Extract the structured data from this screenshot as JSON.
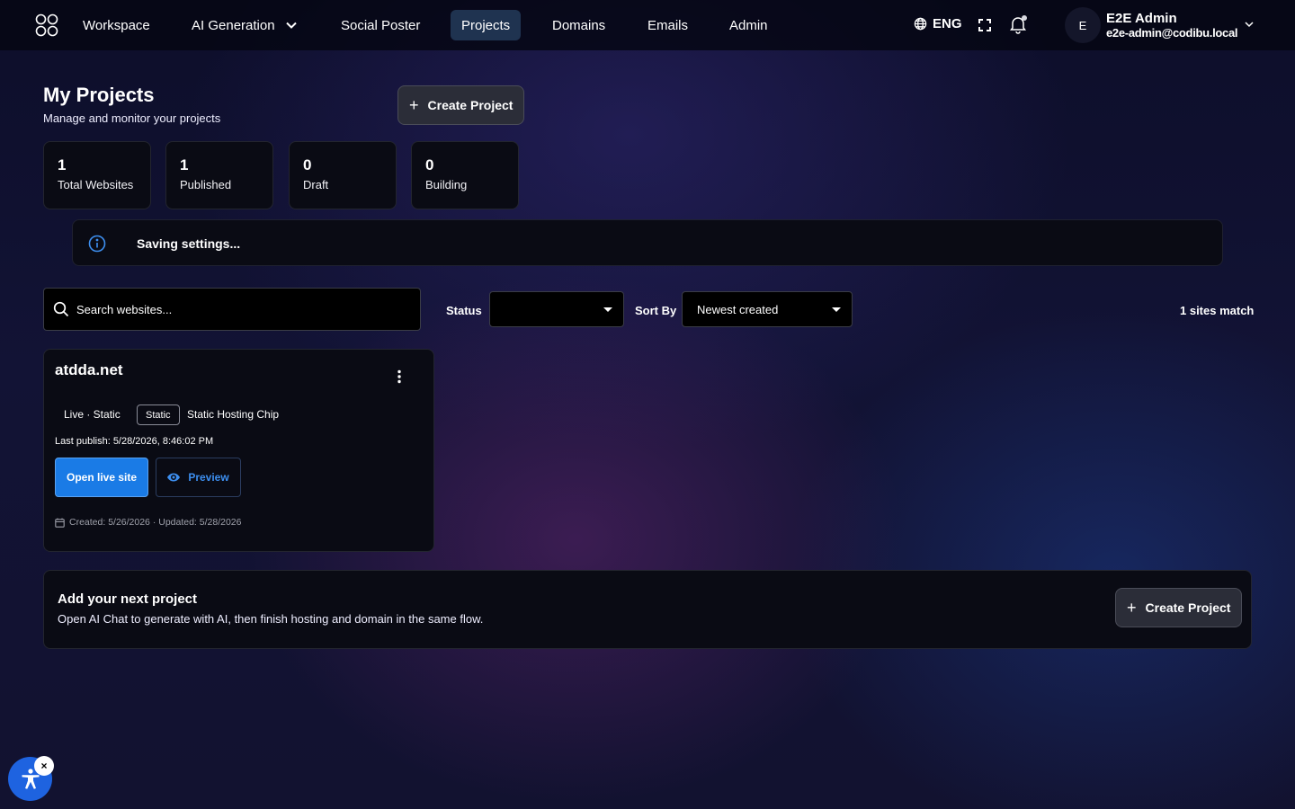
{
  "nav": {
    "items": [
      {
        "label": "Workspace"
      },
      {
        "label": "AI Generation"
      },
      {
        "label": "Social Poster"
      },
      {
        "label": "Projects",
        "active": true
      },
      {
        "label": "Domains"
      },
      {
        "label": "Emails"
      },
      {
        "label": "Admin"
      }
    ],
    "language": "ENG",
    "user": {
      "initial": "E",
      "name": "E2E Admin",
      "email": "e2e-admin@codibu.local"
    }
  },
  "header": {
    "title": "My Projects",
    "subtitle": "Manage and monitor your projects",
    "create_label": "Create Project"
  },
  "stats": [
    {
      "value": "1",
      "label": "Total Websites"
    },
    {
      "value": "1",
      "label": "Published"
    },
    {
      "value": "0",
      "label": "Draft"
    },
    {
      "value": "0",
      "label": "Building"
    }
  ],
  "banner": {
    "message": "Saving settings..."
  },
  "filters": {
    "search_placeholder": "Search websites...",
    "status_label": "Status",
    "status_value": "",
    "sort_label": "Sort By",
    "sort_value": "Newest created",
    "match_text": "1 sites match"
  },
  "project": {
    "domain": "atdda.net",
    "status": "Live · Static",
    "chip": "Static",
    "chip_text": "Static Hosting Chip",
    "last_publish": "Last publish: 5/28/2026, 8:46:02 PM",
    "open_label": "Open live site",
    "preview_label": "Preview",
    "dates": "Created: 5/26/2026 · Updated: 5/28/2026"
  },
  "add_panel": {
    "title": "Add your next project",
    "description": "Open AI Chat to generate with AI, then finish hosting and domain in the same flow.",
    "create_label": "Create Project"
  },
  "colors": {
    "accent": "#1a7be6",
    "active_nav": "#1f3350",
    "preview_text": "#3d8ff0"
  }
}
